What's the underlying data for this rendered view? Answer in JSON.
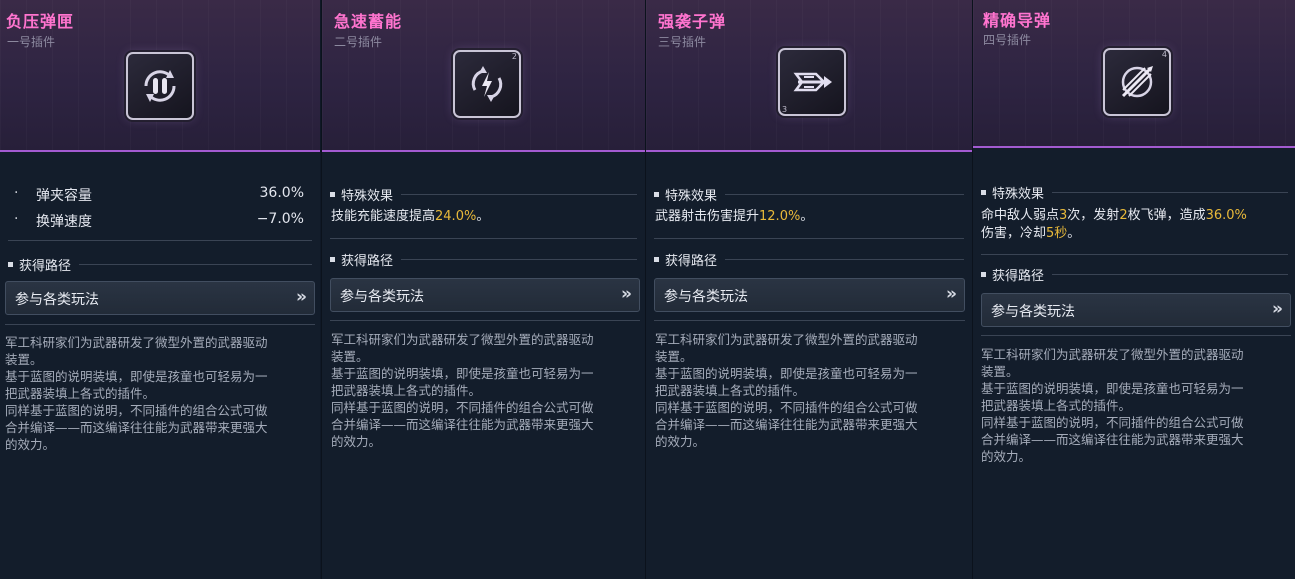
{
  "cards": [
    {
      "title": "负压弹匣",
      "subtitle": "一号插件",
      "icon": "magazine-reload-icon",
      "stats": [
        {
          "name": "弹夹容量",
          "value": "36.0%"
        },
        {
          "name": "换弹速度",
          "value": "−7.0%"
        }
      ],
      "acquire_heading": "获得路径",
      "acquire_button": "参与各类玩法",
      "chevron": "»",
      "lore": [
        "军工科研家们为武器研发了微型外置的武器驱动",
        "装置。",
        "基于蓝图的说明装填，即使是孩童也可轻易为一",
        "把武器装填上各式的插件。",
        "同样基于蓝图的说明，不同插件的组合公式可做",
        "合并编译——而这编译往往能为武器带来更强大",
        "的效力。"
      ]
    },
    {
      "title": "急速蓄能",
      "subtitle": "二号插件",
      "icon": "rapid-charge-icon",
      "icon_tag": "2",
      "effect_heading": "特殊效果",
      "effect_parts": [
        "技能充能速度提高",
        "24.0%",
        "。"
      ],
      "acquire_heading": "获得路径",
      "acquire_button": "参与各类玩法",
      "chevron": "»",
      "lore": [
        "军工科研家们为武器研发了微型外置的武器驱动",
        "装置。",
        "基于蓝图的说明装填，即使是孩童也可轻易为一",
        "把武器装填上各式的插件。",
        "同样基于蓝图的说明，不同插件的组合公式可做",
        "合并编译——而这编译往往能为武器带来更强大",
        "的效力。"
      ]
    },
    {
      "title": "强袭子弹",
      "subtitle": "三号插件",
      "icon": "assault-bullet-icon",
      "icon_tag": "3",
      "effect_heading": "特殊效果",
      "effect_parts": [
        "武器射击伤害提升",
        "12.0%",
        "。"
      ],
      "acquire_heading": "获得路径",
      "acquire_button": "参与各类玩法",
      "chevron": "»",
      "lore": [
        "军工科研家们为武器研发了微型外置的武器驱动",
        "装置。",
        "基于蓝图的说明装填，即使是孩童也可轻易为一",
        "把武器装填上各式的插件。",
        "同样基于蓝图的说明，不同插件的组合公式可做",
        "合并编译——而这编译往往能为武器带来更强大",
        "的效力。"
      ]
    },
    {
      "title": "精确导弹",
      "subtitle": "四号插件",
      "icon": "precision-missile-icon",
      "icon_tag": "4",
      "effect_heading": "特殊效果",
      "effect_line1": [
        "命中敌人弱点",
        "3",
        "次，发射",
        "2",
        "枚飞弹，造成",
        "36.0%"
      ],
      "effect_line2": [
        "伤害，冷却",
        "5秒",
        "。"
      ],
      "acquire_heading": "获得路径",
      "acquire_button": "参与各类玩法",
      "chevron": "»",
      "lore": [
        "军工科研家们为武器研发了微型外置的武器驱动",
        "装置。",
        "基于蓝图的说明装填，即使是孩童也可轻易为一",
        "把武器装填上各式的插件。",
        "同样基于蓝图的说明，不同插件的组合公式可做",
        "合并编译——而这编译往往能为武器带来更强大",
        "的效力。"
      ]
    }
  ]
}
